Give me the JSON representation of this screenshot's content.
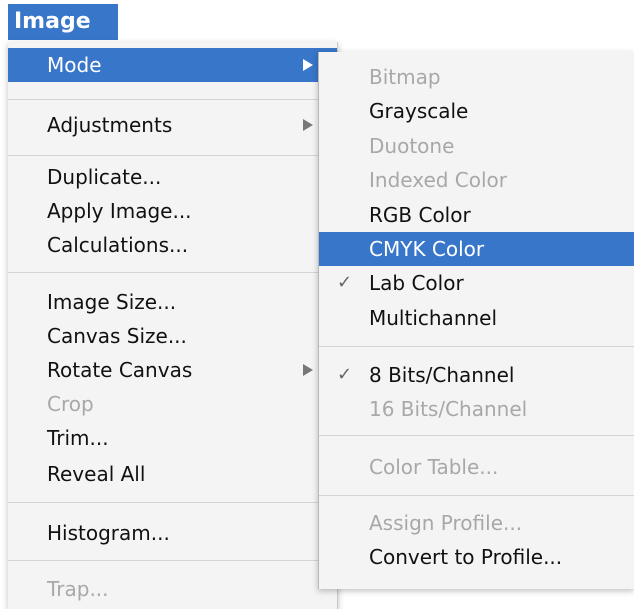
{
  "menubar": {
    "title": "Image"
  },
  "main_menu": {
    "items": [
      {
        "label": "Mode",
        "state": "highlighted",
        "has_submenu": true
      },
      {
        "label": "Adjustments",
        "state": "enabled",
        "has_submenu": true
      },
      {
        "label": "Duplicate...",
        "state": "enabled",
        "has_submenu": false
      },
      {
        "label": "Apply Image...",
        "state": "enabled",
        "has_submenu": false
      },
      {
        "label": "Calculations...",
        "state": "enabled",
        "has_submenu": false
      },
      {
        "label": "Image Size...",
        "state": "enabled",
        "has_submenu": false
      },
      {
        "label": "Canvas Size...",
        "state": "enabled",
        "has_submenu": false
      },
      {
        "label": "Rotate Canvas",
        "state": "enabled",
        "has_submenu": true
      },
      {
        "label": "Crop",
        "state": "disabled",
        "has_submenu": false
      },
      {
        "label": "Trim...",
        "state": "enabled",
        "has_submenu": false
      },
      {
        "label": "Reveal All",
        "state": "enabled",
        "has_submenu": false
      },
      {
        "label": "Histogram...",
        "state": "enabled",
        "has_submenu": false
      },
      {
        "label": "Trap...",
        "state": "disabled",
        "has_submenu": false
      }
    ]
  },
  "mode_submenu": {
    "items": [
      {
        "label": "Bitmap",
        "state": "disabled",
        "checked": false
      },
      {
        "label": "Grayscale",
        "state": "enabled",
        "checked": false
      },
      {
        "label": "Duotone",
        "state": "disabled",
        "checked": false
      },
      {
        "label": "Indexed Color",
        "state": "disabled",
        "checked": false
      },
      {
        "label": "RGB Color",
        "state": "enabled",
        "checked": false
      },
      {
        "label": "CMYK Color",
        "state": "highlighted",
        "checked": false
      },
      {
        "label": "Lab Color",
        "state": "enabled",
        "checked": true
      },
      {
        "label": "Multichannel",
        "state": "enabled",
        "checked": false
      },
      {
        "label": "8 Bits/Channel",
        "state": "enabled",
        "checked": true
      },
      {
        "label": "16 Bits/Channel",
        "state": "disabled",
        "checked": false
      },
      {
        "label": "Color Table...",
        "state": "disabled",
        "checked": false
      },
      {
        "label": "Assign Profile...",
        "state": "disabled",
        "checked": false
      },
      {
        "label": "Convert to Profile...",
        "state": "enabled",
        "checked": false
      }
    ]
  },
  "icons": {
    "submenu_arrow": "triangle-right-icon",
    "checkmark": "checkmark-icon"
  },
  "colors": {
    "highlight": "#3876c9",
    "menu_background": "#f4f4f4",
    "disabled_text": "#a8a8a8"
  }
}
